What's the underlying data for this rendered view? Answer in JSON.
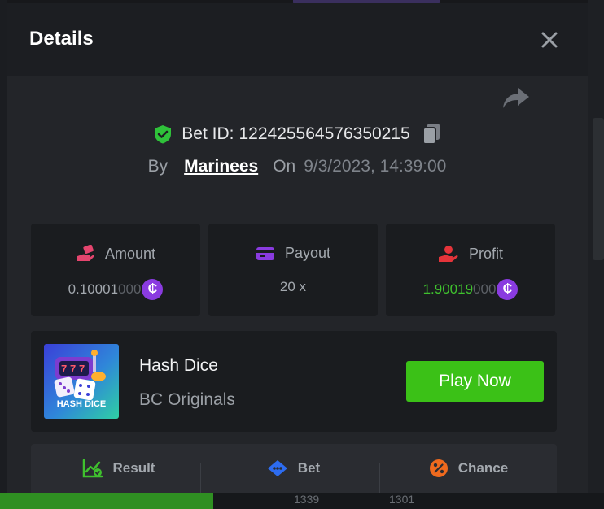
{
  "background": {
    "bottom_numbers": [
      "1339",
      "1301"
    ]
  },
  "modal": {
    "title": "Details",
    "close_icon": "close-icon",
    "share_icon": "share-icon",
    "bet": {
      "label": "Bet ID:",
      "id": "122425564576350215",
      "by_label": "By",
      "user": "Marinees",
      "on_label": "On",
      "timestamp": "9/3/2023, 14:39:00"
    },
    "stats": [
      {
        "label": "Amount",
        "icon": "money-hand-icon",
        "value_main": "0.10001",
        "value_dim": "000",
        "currency_icon": "coin-icon",
        "currency_symbol": "₵"
      },
      {
        "label": "Payout",
        "icon": "wallet-icon",
        "value_main": "20 x",
        "value_dim": ""
      },
      {
        "label": "Profit",
        "icon": "profit-hand-icon",
        "value_main": "1.90019",
        "value_dim": "000",
        "currency_icon": "coin-icon",
        "currency_symbol": "₵"
      }
    ],
    "game": {
      "name": "Hash Dice",
      "provider": "BC Originals",
      "thumb_text": "HASH DICE",
      "play_label": "Play Now"
    },
    "tabs": [
      {
        "label": "Result",
        "icon": "chart-check-icon"
      },
      {
        "label": "Bet",
        "icon": "bet-tag-icon"
      },
      {
        "label": "Chance",
        "icon": "percent-icon"
      }
    ]
  },
  "colors": {
    "accent_green": "#3bc117",
    "coin_purple": "#8a3be0",
    "shield_green": "#2fc23a",
    "amount_pink": "#e5456e",
    "payout_purple": "#8a3be0",
    "profit_red": "#e5343a"
  }
}
